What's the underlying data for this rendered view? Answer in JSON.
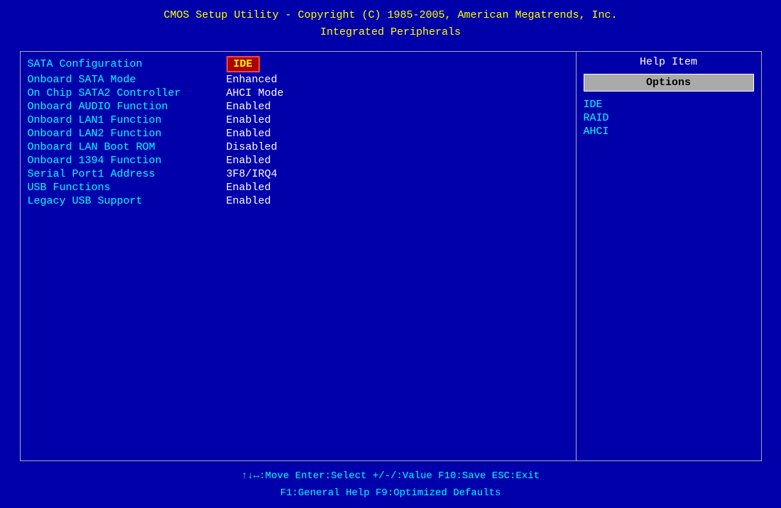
{
  "header": {
    "line1": "CMOS Setup Utility - Copyright (C) 1985-2005, American Megatrends, Inc.",
    "line2": "Integrated Peripherals"
  },
  "settings": [
    {
      "label": "SATA Configuration",
      "value": "IDE",
      "selected": true
    },
    {
      "label": "Onboard SATA Mode",
      "value": "Enhanced",
      "selected": false
    },
    {
      "label": "On Chip SATA2 Controller",
      "value": "AHCI Mode",
      "selected": false
    },
    {
      "label": "Onboard AUDIO Function",
      "value": "Enabled",
      "selected": false
    },
    {
      "label": "Onboard LAN1 Function",
      "value": "Enabled",
      "selected": false
    },
    {
      "label": "Onboard LAN2 Function",
      "value": "Enabled",
      "selected": false
    },
    {
      "label": "Onboard LAN Boot ROM",
      "value": "Disabled",
      "selected": false
    },
    {
      "label": "Onboard 1394 Function",
      "value": "Enabled",
      "selected": false
    },
    {
      "label": "Serial Port1 Address",
      "value": "3F8/IRQ4",
      "selected": false
    },
    {
      "label": "USB Functions",
      "value": "Enabled",
      "selected": false
    },
    {
      "label": "Legacy USB Support",
      "value": "Enabled",
      "selected": false
    }
  ],
  "help": {
    "title": "Help Item",
    "options_label": "Options",
    "options": [
      "IDE",
      "RAID",
      "AHCI"
    ]
  },
  "footer": {
    "line1": "↑↓↔:Move   Enter:Select   +/-/:Value   F10:Save   ESC:Exit",
    "line2": "F1:General Help                F9:Optimized Defaults"
  }
}
